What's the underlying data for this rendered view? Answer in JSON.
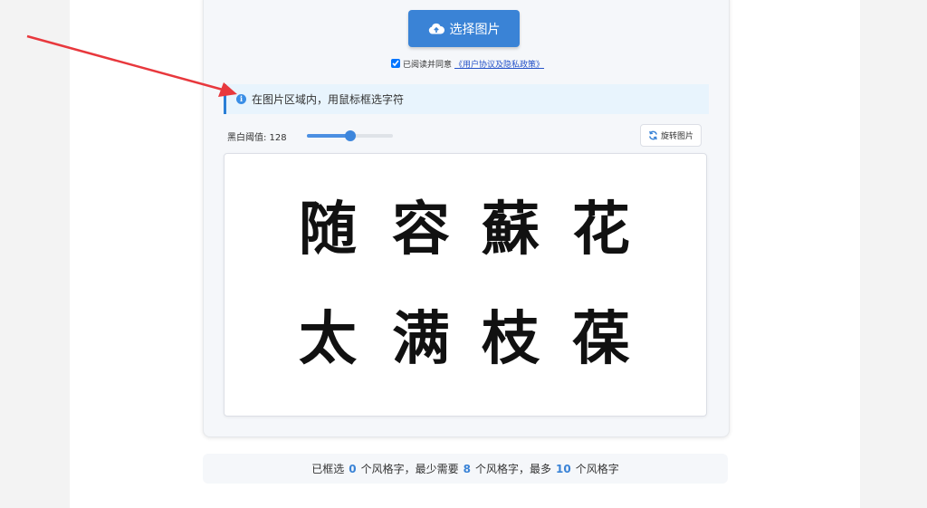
{
  "upload": {
    "label": "选择图片",
    "icon": "cloud-upload-icon"
  },
  "agreement": {
    "checked": true,
    "text": "已阅读并同意",
    "link": "《用户协议及隐私政策》"
  },
  "tip": {
    "icon": "info-icon",
    "text": "在图片区域内，用鼠标框选字符"
  },
  "threshold": {
    "label": "黑白阈值: 128",
    "value": 128,
    "min": 0,
    "max": 255
  },
  "rotate": {
    "label": "旋转图片",
    "icon": "rotate-icon"
  },
  "canvas": {
    "characters": [
      "随",
      "容",
      "蘇",
      "花",
      "太",
      "满",
      "枝",
      "葆"
    ]
  },
  "status": {
    "prefix": "已框选",
    "selected": "0",
    "mid1": "个风格字，最少需要",
    "min": "8",
    "mid2": "个风格字，最多",
    "max": "10",
    "suffix": "个风格字"
  },
  "colors": {
    "accent": "#3a83d6",
    "arrow": "#e8383d",
    "tip_bg": "#e8f4fd"
  }
}
